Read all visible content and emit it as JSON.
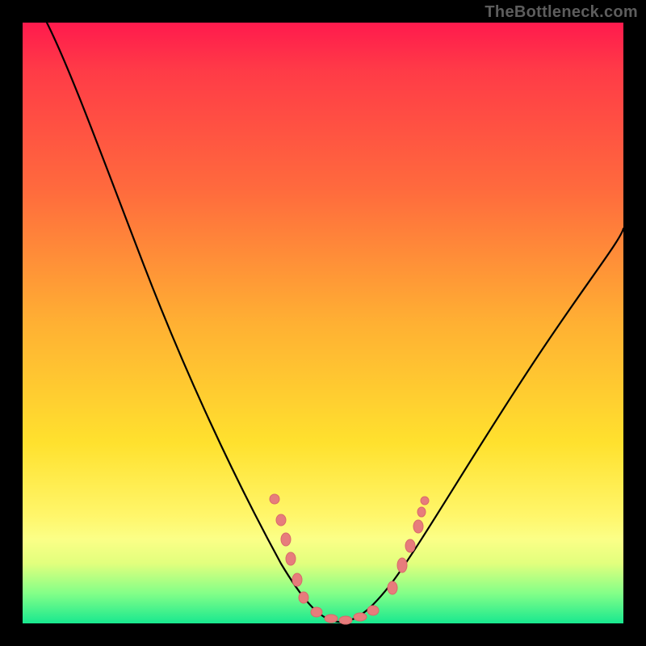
{
  "watermark": "TheBottleneck.com",
  "chart_data": {
    "type": "line",
    "title": "",
    "xlabel": "",
    "ylabel": "",
    "xlim": [
      0,
      100
    ],
    "ylim": [
      0,
      100
    ],
    "grid": false,
    "legend": false,
    "background_gradient": {
      "direction": "top-to-bottom",
      "stops": [
        {
          "pct": 0,
          "color": "#ff1a4d"
        },
        {
          "pct": 28,
          "color": "#ff6b3d"
        },
        {
          "pct": 50,
          "color": "#ffb033"
        },
        {
          "pct": 70,
          "color": "#ffe12e"
        },
        {
          "pct": 86,
          "color": "#fbff87"
        },
        {
          "pct": 95,
          "color": "#83ff88"
        },
        {
          "pct": 100,
          "color": "#18e88f"
        }
      ]
    },
    "series": [
      {
        "name": "bottleneck-curve",
        "color": "#000000",
        "stroke_width": 2,
        "x": [
          4,
          10,
          16,
          22,
          28,
          34,
          40,
          44,
          48,
          50,
          52,
          54,
          56,
          60,
          66,
          74,
          82,
          90,
          100
        ],
        "y": [
          100,
          88,
          76,
          63,
          50,
          37,
          24,
          14,
          6,
          2,
          0,
          0,
          2,
          6,
          14,
          28,
          42,
          54,
          66
        ]
      },
      {
        "name": "valley-markers",
        "color": "#e77c7c",
        "type": "scatter",
        "marker": "oval",
        "x": [
          40,
          42,
          44,
          46,
          48,
          50,
          52,
          56,
          60,
          62,
          64
        ],
        "y": [
          22,
          18,
          12,
          8,
          4,
          1,
          0,
          2,
          8,
          12,
          16
        ]
      }
    ]
  }
}
